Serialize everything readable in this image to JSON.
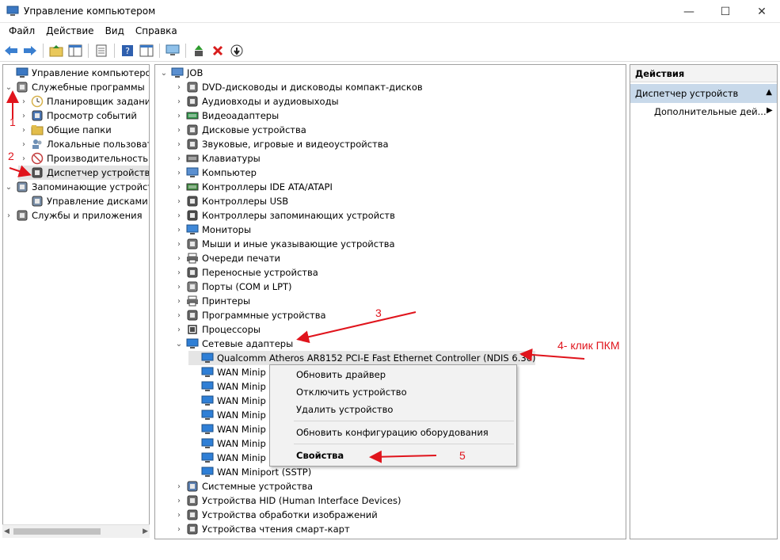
{
  "window": {
    "title": "Управление компьютером",
    "minimize_glyph": "—",
    "maximize_glyph": "☐",
    "close_glyph": "✕"
  },
  "menubar": [
    "Файл",
    "Действие",
    "Вид",
    "Справка"
  ],
  "toolbar": [
    "back-icon",
    "forward-icon",
    "up-folder-icon",
    "show-tree-icon",
    "properties-icon",
    "help-icon",
    "view-icon",
    "monitor-icon",
    "update-driver-icon",
    "uninstall-icon",
    "disable-icon"
  ],
  "left_tree": [
    {
      "label": "Управление компьютером (л",
      "icon": "computer-management-icon",
      "level": 0,
      "expander": ""
    },
    {
      "label": "Служебные программы",
      "icon": "tools-icon",
      "level": 0,
      "expander": "⌄"
    },
    {
      "label": "Планировщик заданий",
      "icon": "clock-icon",
      "level": 1,
      "expander": "›"
    },
    {
      "label": "Просмотр событий",
      "icon": "event-viewer-icon",
      "level": 1,
      "expander": "›"
    },
    {
      "label": "Общие папки",
      "icon": "shared-folder-icon",
      "level": 1,
      "expander": "›"
    },
    {
      "label": "Локальные пользовате",
      "icon": "users-icon",
      "level": 1,
      "expander": "›"
    },
    {
      "label": "Производительность",
      "icon": "performance-icon",
      "level": 1,
      "expander": "›"
    },
    {
      "label": "Диспетчер устройств",
      "icon": "device-manager-icon",
      "level": 1,
      "expander": "",
      "selected": true
    },
    {
      "label": "Запоминающие устройст",
      "icon": "storage-icon",
      "level": 0,
      "expander": "⌄"
    },
    {
      "label": "Управление дисками",
      "icon": "disk-icon",
      "level": 1,
      "expander": ""
    },
    {
      "label": "Службы и приложения",
      "icon": "services-icon",
      "level": 0,
      "expander": "›"
    }
  ],
  "device_tree": [
    {
      "label": "JOB",
      "icon": "computer-icon",
      "level": 0,
      "expander": "⌄"
    },
    {
      "label": "DVD-дисководы и дисководы компакт-дисков",
      "icon": "dvd-icon",
      "level": 1,
      "expander": "›"
    },
    {
      "label": "Аудиовходы и аудиовыходы",
      "icon": "audio-icon",
      "level": 1,
      "expander": "›"
    },
    {
      "label": "Видеоадаптеры",
      "icon": "display-adapter-icon",
      "level": 1,
      "expander": "›"
    },
    {
      "label": "Дисковые устройства",
      "icon": "disk-drive-icon",
      "level": 1,
      "expander": "›"
    },
    {
      "label": "Звуковые, игровые и видеоустройства",
      "icon": "sound-icon",
      "level": 1,
      "expander": "›"
    },
    {
      "label": "Клавиатуры",
      "icon": "keyboard-icon",
      "level": 1,
      "expander": "›"
    },
    {
      "label": "Компьютер",
      "icon": "computer-icon",
      "level": 1,
      "expander": "›"
    },
    {
      "label": "Контроллеры IDE ATA/ATAPI",
      "icon": "ide-controller-icon",
      "level": 1,
      "expander": "›"
    },
    {
      "label": "Контроллеры USB",
      "icon": "usb-icon",
      "level": 1,
      "expander": "›"
    },
    {
      "label": "Контроллеры запоминающих устройств",
      "icon": "storage-controller-icon",
      "level": 1,
      "expander": "›"
    },
    {
      "label": "Мониторы",
      "icon": "monitor-icon",
      "level": 1,
      "expander": "›"
    },
    {
      "label": "Мыши и иные указывающие устройства",
      "icon": "mouse-icon",
      "level": 1,
      "expander": "›"
    },
    {
      "label": "Очереди печати",
      "icon": "print-queue-icon",
      "level": 1,
      "expander": "›"
    },
    {
      "label": "Переносные устройства",
      "icon": "portable-device-icon",
      "level": 1,
      "expander": "›"
    },
    {
      "label": "Порты (COM и LPT)",
      "icon": "port-icon",
      "level": 1,
      "expander": "›"
    },
    {
      "label": "Принтеры",
      "icon": "printer-icon",
      "level": 1,
      "expander": "›"
    },
    {
      "label": "Программные устройства",
      "icon": "software-device-icon",
      "level": 1,
      "expander": "›"
    },
    {
      "label": "Процессоры",
      "icon": "processor-icon",
      "level": 1,
      "expander": "›"
    },
    {
      "label": "Сетевые адаптеры",
      "icon": "network-adapter-icon",
      "level": 1,
      "expander": "⌄"
    },
    {
      "label": "Qualcomm Atheros AR8152 PCI-E Fast Ethernet Controller (NDIS 6.30)",
      "icon": "network-adapter-icon",
      "level": 2,
      "expander": "",
      "selected": true
    },
    {
      "label": "WAN Minip",
      "icon": "network-adapter-icon",
      "level": 2,
      "expander": ""
    },
    {
      "label": "WAN Minip",
      "icon": "network-adapter-icon",
      "level": 2,
      "expander": ""
    },
    {
      "label": "WAN Minip",
      "icon": "network-adapter-icon",
      "level": 2,
      "expander": ""
    },
    {
      "label": "WAN Minip",
      "icon": "network-adapter-icon",
      "level": 2,
      "expander": ""
    },
    {
      "label": "WAN Minip",
      "icon": "network-adapter-icon",
      "level": 2,
      "expander": ""
    },
    {
      "label": "WAN Minip",
      "icon": "network-adapter-icon",
      "level": 2,
      "expander": ""
    },
    {
      "label": "WAN Minip",
      "icon": "network-adapter-icon",
      "level": 2,
      "expander": ""
    },
    {
      "label": "WAN Miniport (SSTP)",
      "icon": "network-adapter-icon",
      "level": 2,
      "expander": ""
    },
    {
      "label": "Системные устройства",
      "icon": "system-device-icon",
      "level": 1,
      "expander": "›"
    },
    {
      "label": "Устройства HID (Human Interface Devices)",
      "icon": "hid-icon",
      "level": 1,
      "expander": "›"
    },
    {
      "label": "Устройства обработки изображений",
      "icon": "imaging-device-icon",
      "level": 1,
      "expander": "›"
    },
    {
      "label": "Устройства чтения смарт-карт",
      "icon": "smart-card-icon",
      "level": 1,
      "expander": "›"
    }
  ],
  "actions": {
    "header": "Действия",
    "section": "Диспетчер устройств",
    "section_glyph": "▲",
    "more": "Дополнительные дей...",
    "more_glyph": "▶"
  },
  "context_menu": {
    "update_driver": "Обновить драйвер",
    "disable": "Отключить устройство",
    "uninstall": "Удалить устройство",
    "scan": "Обновить конфигурацию оборудования",
    "properties": "Свойства"
  },
  "annotations": {
    "n1": "1",
    "n2": "2",
    "n3": "3",
    "n4": "4- клик ПКМ",
    "n5": "5"
  },
  "colors": {
    "annotation": "#e0141c",
    "selection": "#e5e5e5",
    "actions_section": "#c8d9ea",
    "menu_bg": "#f2f2f2"
  }
}
